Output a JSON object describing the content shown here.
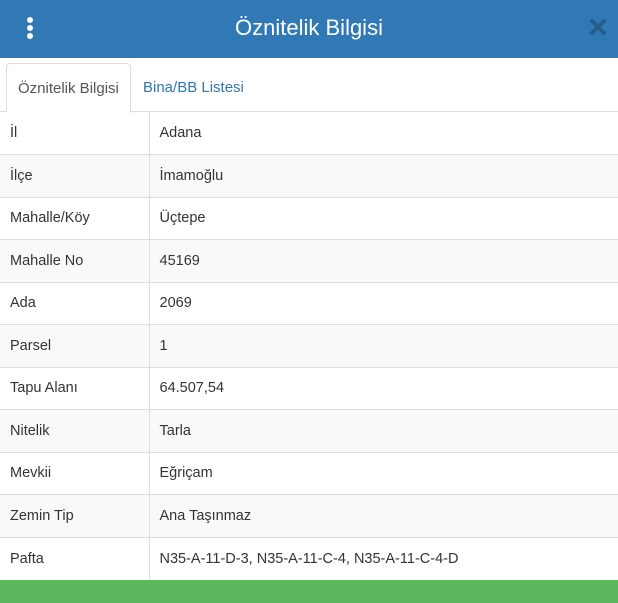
{
  "header": {
    "title": "Öznitelik Bilgisi",
    "background": "#3079b5",
    "menu_icon": "vertical-ellipsis-icon",
    "close_icon": "close-icon"
  },
  "tabs": [
    {
      "label": "Öznitelik Bilgisi",
      "active": true
    },
    {
      "label": "Bina/BB Listesi",
      "active": false
    }
  ],
  "attributes": [
    {
      "key": "İl",
      "value": "Adana"
    },
    {
      "key": "İlçe",
      "value": "İmamoğlu"
    },
    {
      "key": "Mahalle/Köy",
      "value": "Üçtepe"
    },
    {
      "key": "Mahalle No",
      "value": "45169"
    },
    {
      "key": "Ada",
      "value": "2069"
    },
    {
      "key": "Parsel",
      "value": "1"
    },
    {
      "key": "Tapu Alanı",
      "value": "64.507,54"
    },
    {
      "key": "Nitelik",
      "value": "Tarla"
    },
    {
      "key": "Mevkii",
      "value": "Eğriçam"
    },
    {
      "key": "Zemin Tip",
      "value": "Ana Taşınmaz"
    },
    {
      "key": "Pafta",
      "value": "N35-A-11-D-3, N35-A-11-C-4, N35-A-11-C-4-D"
    }
  ],
  "footer": {
    "background": "#5cb85c"
  }
}
